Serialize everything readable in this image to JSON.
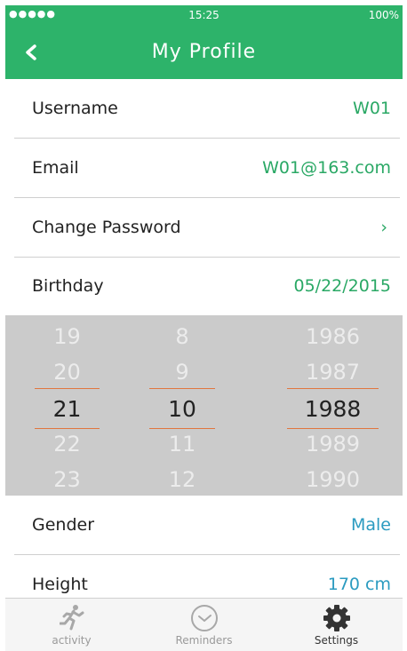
{
  "status_bar": {
    "signal": "●●●●●",
    "time": "15:25",
    "battery": "100%"
  },
  "header": {
    "title": "My Profile",
    "back_icon": "chevron-left-icon"
  },
  "rows": {
    "username": {
      "label": "Username",
      "value": "W01"
    },
    "email": {
      "label": "Email",
      "value": "W01@163.com"
    },
    "change_password": {
      "label": "Change Password",
      "chevron": "›"
    },
    "birthday": {
      "label": "Birthday",
      "value": "05/22/2015"
    },
    "gender": {
      "label": "Gender",
      "value": "Male"
    },
    "height": {
      "label": "Height",
      "value": "170 cm"
    }
  },
  "picker": {
    "day": [
      "19",
      "20",
      "21",
      "22",
      "23"
    ],
    "month": [
      "8",
      "9",
      "10",
      "11",
      "12"
    ],
    "year": [
      "1986",
      "1987",
      "1988",
      "1989",
      "1990"
    ]
  },
  "tabs": [
    {
      "label": "activity",
      "icon": "running-icon"
    },
    {
      "label": "Reminders",
      "icon": "clock-icon"
    },
    {
      "label": "Settings",
      "icon": "gear-icon"
    }
  ],
  "colors": {
    "header": "#2db36a",
    "accent_green": "#2aa865",
    "accent_blue": "#2b9bc0",
    "picker_bg": "#cbcbcb",
    "picker_line": "#e0763f"
  }
}
